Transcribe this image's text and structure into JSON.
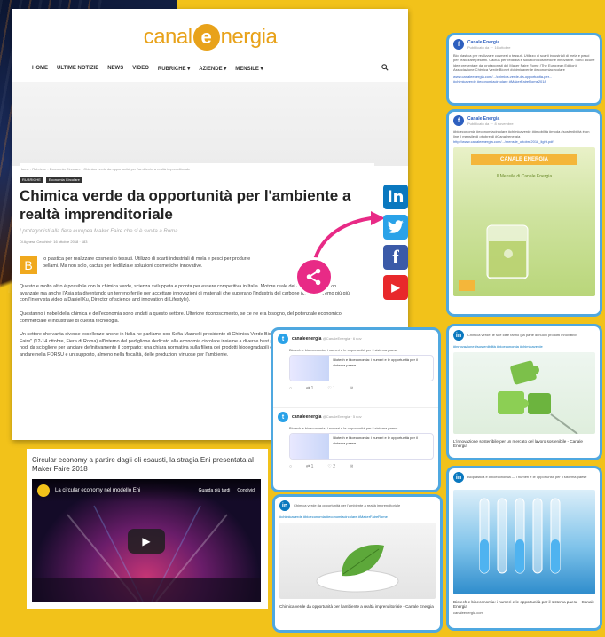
{
  "site": {
    "logo_left": "canal",
    "logo_e": "e",
    "logo_right": "nergia",
    "nav": [
      "HOME",
      "ULTIME NOTIZIE",
      "NEWS",
      "VIDEO",
      "RUBRICHE ▾",
      "AZIENDE ▾",
      "MENSILE ▾"
    ],
    "search_icon": "search-icon"
  },
  "article": {
    "breadcrumb": "Home › Rubriche › Economia Circolare › Chimica verde da opportunità per l'ambiente a realtà imprenditoriale",
    "tags": [
      "RUBRICHE",
      "Economia Circolare"
    ],
    "title": "Chimica verde da opportunità per l'ambiente a realtà imprenditoriale",
    "subtitle": "I protagonisti alla fiera europea Maker Faire che si è svolta a Roma",
    "meta": "Di Agnese Cecchini · 16 ottobre 2018 · 183",
    "dropcap": "B",
    "lead": "io plastica per realizzare cosmesi o tessuti. Utilizzo di scarti industriali di mela e pesci per produrre pellami. Ma non solo, cactus per l'edilizia e soluzioni cosmetiche innovative.",
    "p1": "Questo e molto altro è possibile con la chimica verde, scienza sviluppata e pronta per essere competitiva in Italia. Motore reale del nostro Paese sono avanzate ma anche l'Asia sta diventando un terreno fertile per accettare innovazioni di materiali che superano l'industria del carbone (come vedremo più giù con l'intervista video a Daniel Ku, Director of science and innovation di Lifestyle).",
    "p2": "Questanno i nobel della chimica e dell'economia sono andati a questo settore. Ulteriore riconoscimento, se ce ne era bisogno, del potenziale economico, commerciale e industriale di questa tecnologia.",
    "p3": "Un settore che vanta diverse eccellenze anche in Italia ne parliamo con Sofia Mannelli presidente di Chimica Verde Bionet incontrata nel corso del \"Maker Faire\" (12-14 ottobre, Fiera di Roma) all'interno del padiglione dedicato alla economia circolare insieme a diverse best pratices del settore. Mancano alcuni nodi da sciogliere per lanciare definitivamente il comparto: una chiara normativa sulla filiera dei prodotti biodegradabili e biocompostabili che devono poter andare nella FORSU e un supporto, almeno nella fiscalità, delle produzioni virtuose per l'ambiente."
  },
  "video": {
    "caption": "Circular economy a partire dagli oli esausti, la stragia Eni presentata al Maker Faire 2018",
    "player_title": "La circular economy nel modello Eni",
    "watch_later": "Guarda più tardi",
    "share": "Condividi"
  },
  "share": {
    "linkedin": "in",
    "twitter": "🐦",
    "facebook": "f",
    "youtube": "▶",
    "share_icon": "share-icon"
  },
  "posts": {
    "fb1": {
      "name": "Canale Energia",
      "sub": "Pubblicato da ··· 16 ottobre",
      "text": "Bio plastica per realizzare cosmesi o tessuti. Utilizzo di scarti industriali di mela e pesci per realizzare pellami. Cactus per l'edilizia e soluzioni cosmetiche innovative. Sono alcune idee presentate dai protagonisti del Maker Faire Rome (The European Edition) Associazione Chimica Verde Bionet #chimicaverde #economiacircolare",
      "link": "www.canaleenergia.com/.../chimica-verde-da-opportunita-per...",
      "tags": "#chimicaverde #economiacircolare #MakerFaireRome2018"
    },
    "fb2": {
      "name": "Canale Energia",
      "sub": "Pubblicato da ··· 8 novembre",
      "text": "#bioeconomia #economiacircolare #chimicaverde ##mobilità #moda #sostenibilità é on line il mensile di ottobre di #Canaleenergia",
      "link": "http://www.canaleenergia.com/.../mensile_ottobre2018_light.pdf",
      "img_title": "CANALE ENERGIA",
      "img_sub": "Il Mensile di Canale Energia"
    },
    "li1": {
      "text": "Chimica verde: le sue idee fanno già parte di nuovi prodotti innovativi!",
      "tags": "#innovazione #sostenibilità #bioeconomia #chimicaverde",
      "caption": "L'innovazione sostenibile per un mercato del lavoro sostenibile - Canale Energia"
    },
    "li2": {
      "text": "Bioplastica e #bioeconomia — i numeri e le opportunità per il sistema paese",
      "caption": "Biotech e bioeconomia: i numeri e le opportunità per il sistema paese - Canale Energia",
      "site": "canaleenergia.com"
    },
    "tw1": {
      "name": "canaleenergia",
      "handle": "@CanaleEnergia · 6 nov",
      "text": "Biotech e bioeconomia, i numeri e le opportunità per il sistema paese",
      "embed": "Biotech e bioeconomia: i numeri e le opportunità per il sistema paese",
      "counts": [
        "",
        "1",
        "1"
      ]
    },
    "tw2": {
      "name": "canaleenergia",
      "handle": "@CanaleEnergia · 5 nov",
      "text": "Biotech e bioeconomia, i numeri e le opportunità per il sistema paese",
      "embed": "Biotech e bioeconomia: i numeri e le opportunità per il sistema paese",
      "counts": [
        "",
        "1",
        "2"
      ]
    },
    "li3": {
      "text": "Chimica verde da opportunità per l'ambiente a realtà imprenditoriale",
      "tags": "#chimicaverde #bioeconomia #economiacircolare #MakerFaireRome",
      "caption": "Chimica verde da opportunità per l'ambiente a realtà imprenditoriale - Canale Energia"
    }
  },
  "colors": {
    "background": "#f2c21a",
    "brand": "#e8a21a",
    "linkedin": "#0a78bf",
    "twitter": "#2aa2e8",
    "facebook": "#3b5aa8",
    "youtube": "#e8282b",
    "share": "#e82a86"
  }
}
